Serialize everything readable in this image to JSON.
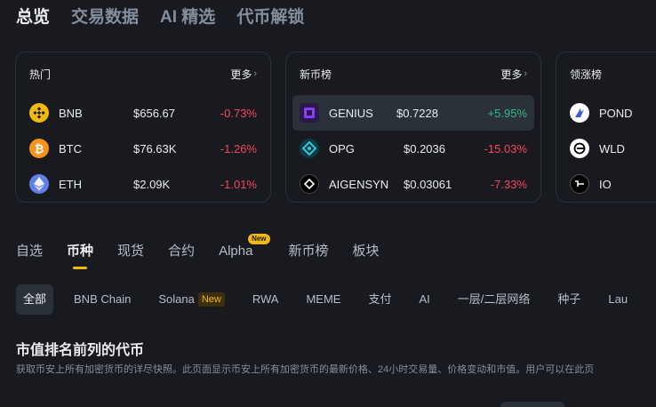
{
  "top_tabs": [
    "总览",
    "交易数据",
    "AI 精选",
    "代币解锁"
  ],
  "hot_card": {
    "title": "热门",
    "more": "更多",
    "rows": [
      {
        "symbol": "BNB",
        "price": "$656.67",
        "change": "-0.73%",
        "icon": "bnb-icon"
      },
      {
        "symbol": "BTC",
        "price": "$76.63K",
        "change": "-1.26%",
        "icon": "btc-icon"
      },
      {
        "symbol": "ETH",
        "price": "$2.09K",
        "change": "-1.01%",
        "icon": "eth-icon"
      }
    ]
  },
  "new_card": {
    "title": "新币榜",
    "more": "更多",
    "rows": [
      {
        "symbol": "GENIUS",
        "price": "$0.7228",
        "change": "+5.95%",
        "icon": "genius-icon"
      },
      {
        "symbol": "OPG",
        "price": "$0.2036",
        "change": "-15.03%",
        "icon": "opg-icon"
      },
      {
        "symbol": "AIGENSYN",
        "price": "$0.03061",
        "change": "-7.33%",
        "icon": "aigensyn-icon"
      }
    ]
  },
  "gainers_card": {
    "title": "领涨榜",
    "rows": [
      {
        "symbol": "POND",
        "icon": "pond-icon"
      },
      {
        "symbol": "WLD",
        "icon": "wld-icon"
      },
      {
        "symbol": "IO",
        "icon": "io-icon"
      }
    ]
  },
  "sub_tabs": [
    "自选",
    "币种",
    "现货",
    "合约",
    "Alpha",
    "新币榜",
    "板块"
  ],
  "alpha_badge": "New",
  "chips": [
    "全部",
    "BNB Chain",
    "Solana",
    "RWA",
    "MEME",
    "支付",
    "AI",
    "一层/二层网络",
    "种子",
    "Lau"
  ],
  "solana_badge": "New",
  "section": {
    "title": "市值排名前列的代币",
    "desc": "获取币安上所有加密货币的详尽快照。此页面显示币安上所有加密货币的最新价格、24小时交易量、价格变动和市值。用户可以在此页"
  },
  "colors": {
    "accent": "#f0b90b",
    "negative": "#f6465d",
    "positive": "#2ebd85",
    "background": "#181a20"
  }
}
